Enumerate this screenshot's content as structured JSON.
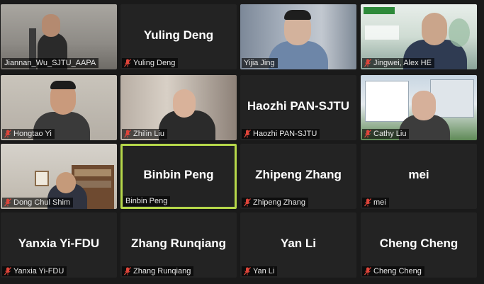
{
  "participants": [
    {
      "name": "Jiannan_Wu_SJTU_AAPA",
      "muted": false,
      "video": true
    },
    {
      "name": "Yuling Deng",
      "muted": true,
      "video": false
    },
    {
      "name": "Yijia Jing",
      "muted": false,
      "video": true
    },
    {
      "name": "Jingwei, Alex HE",
      "muted": true,
      "video": true
    },
    {
      "name": "Hongtao Yi",
      "muted": true,
      "video": true
    },
    {
      "name": "Zhilin Liu",
      "muted": true,
      "video": true
    },
    {
      "name": "Haozhi PAN-SJTU",
      "muted": true,
      "video": false
    },
    {
      "name": "Cathy Liu",
      "muted": true,
      "video": true
    },
    {
      "name": "Dong Chul Shim",
      "muted": true,
      "video": true
    },
    {
      "name": "Binbin Peng",
      "muted": false,
      "video": false,
      "active_speaker": true
    },
    {
      "name": "Zhipeng Zhang",
      "muted": true,
      "video": false
    },
    {
      "name": "mei",
      "muted": true,
      "video": false
    },
    {
      "name": "Yanxia Yi-FDU",
      "muted": true,
      "video": false
    },
    {
      "name": "Zhang Runqiang",
      "muted": true,
      "video": false
    },
    {
      "name": "Yan Li",
      "muted": true,
      "video": false
    },
    {
      "name": "Cheng Cheng",
      "muted": true,
      "video": false
    }
  ],
  "colors": {
    "active_border": "#b6d84a",
    "muted_icon": "#e0453a",
    "tile_bg": "#232323"
  }
}
